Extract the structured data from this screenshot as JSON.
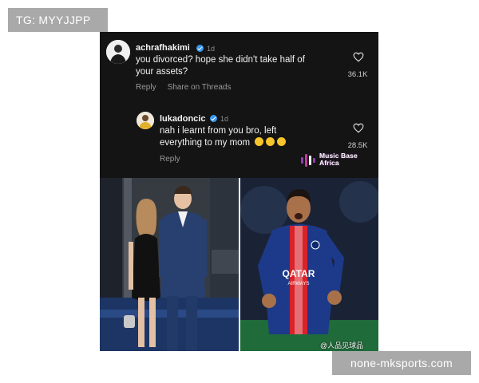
{
  "top_badge": {
    "text": "TG: MYYJJPP"
  },
  "comments": [
    {
      "username": "achrafhakimi",
      "time": "1d",
      "lines": [
        "you divorced? hope she didn't take half of",
        "your assets?"
      ],
      "like_count": "36.1K",
      "actions": [
        "Reply",
        "Share on Threads"
      ]
    },
    {
      "username": "lukadoncic",
      "time": "1d",
      "lines": [
        "nah i learnt from you bro, left",
        "everything to my mom"
      ],
      "emoji": [
        "laughing-emoji",
        "laughing-emoji",
        "laughing-emoji"
      ],
      "like_count": "28.5K",
      "actions": [
        "Reply"
      ]
    }
  ],
  "watermark_logo": {
    "line1": "Music Base",
    "line2": "Africa"
  },
  "jersey": {
    "line1": "QATAR",
    "line2": "AIRWAYS"
  },
  "photo_watermark": {
    "text": "@人品见球品"
  },
  "bottom_badge": {
    "text": "none-mksports.com"
  },
  "colors": {
    "thread_bg": "#141414",
    "verified": "#3897f0",
    "psg_blue": "#1d3a8a",
    "psg_red": "#d8232a"
  }
}
